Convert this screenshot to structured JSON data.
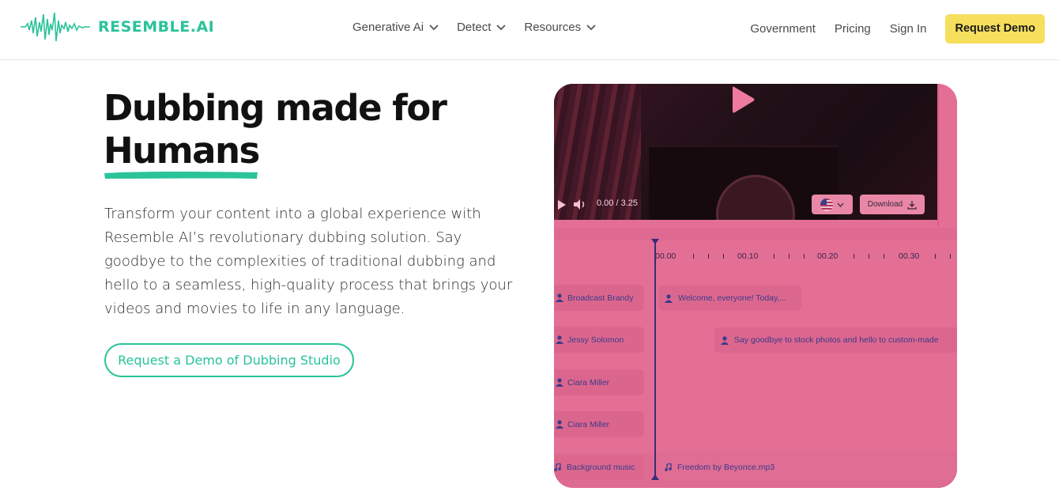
{
  "nav": {
    "brand": "RESEMBLE.AI",
    "menu": [
      {
        "label": "Generative Ai"
      },
      {
        "label": "Detect"
      },
      {
        "label": "Resources"
      }
    ],
    "links": [
      "Government",
      "Pricing",
      "Sign In"
    ],
    "cta_label": "Request Demo",
    "cta_color": "#f5df5c",
    "brand_color": "#2ac39a"
  },
  "hero": {
    "title_line1": "Dubbing made for",
    "title_line2": "Humans",
    "description": "Transform your content into a global experience with Resemble AI’s revolutionary dubbing solution. Say goodbye to the complexities of traditional dubbing and hello to a seamless, high-quality process that brings your videos and movies to life in any language.",
    "button_label": "Request a Demo of Dubbing Studio"
  },
  "studio": {
    "video_time": "0.00 / 3.25",
    "download_label": "Download",
    "language_icon": "us-flag-icon",
    "ruler": [
      "00.00",
      "00.10",
      "00.20",
      "00.30"
    ],
    "tracks": [
      {
        "speaker": "Broadcast Brandy",
        "clip": "Welcome, everyone! Today,..."
      },
      {
        "speaker": "Jessy Solomon",
        "clip": "Say goodbye to stock photos and hello to custom-made"
      },
      {
        "speaker": "Ciara Miller",
        "clip": ""
      },
      {
        "speaker": "Ciara Miller",
        "clip": ""
      }
    ],
    "music": {
      "label": "Background music",
      "clip": "Freedom by Beyonce.mp3"
    },
    "overlay_color": "#e36f95"
  }
}
